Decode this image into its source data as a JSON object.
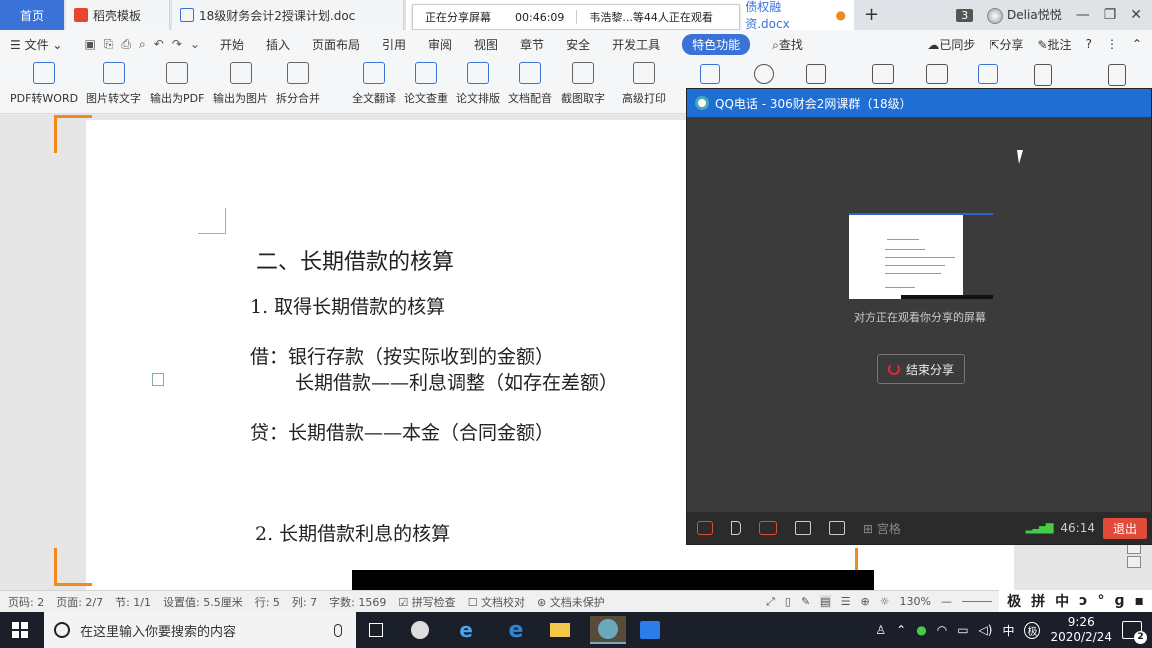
{
  "tabs": {
    "home": "首页",
    "template": "稻壳模板",
    "doc1": "18级财务会计2授课计划.doc",
    "doc2": "债权融资.docx",
    "new_tab": "+",
    "window_count": "3",
    "user": "Delia悦悦"
  },
  "share_banner": {
    "status": "正在分享屏幕",
    "timer": "00:46:09",
    "viewers": "韦浩黎...等44人正在观看"
  },
  "menubar": {
    "file": "文件",
    "items": [
      "开始",
      "插入",
      "页面布局",
      "引用",
      "审阅",
      "视图",
      "章节",
      "安全",
      "开发工具"
    ],
    "special": "特色功能",
    "search": "查找",
    "sync": "已同步",
    "share": "分享",
    "comment": "批注"
  },
  "ribbon": {
    "tools": [
      "PDF转WORD",
      "图片转文字",
      "输出为PDF",
      "输出为图片",
      "拆分合并",
      "全文翻译",
      "论文查重",
      "论文排版",
      "文档配音",
      "截图取字",
      "高级打印"
    ]
  },
  "document": {
    "heading": "二、长期借款的核算",
    "item1": "1. 取得长期借款的核算",
    "debit1": "借：银行存款（按实际收到的金额）",
    "debit2": "长期借款——利息调整（如存在差额）",
    "credit": "贷：长期借款——本金（合同金额）",
    "item2": "2. 长期借款利息的核算"
  },
  "qq": {
    "title": "QQ电话 - 306财会2网课群（18级）",
    "watching": "对方正在观看你分享的屏幕",
    "end_share": "结束分享",
    "grid": "宫格",
    "duration": "46:14",
    "exit": "退出"
  },
  "statusbar": {
    "page": "页码: 2",
    "pages": "页面: 2/7",
    "section": "节: 1/1",
    "setting": "设置值: 5.5厘米",
    "row": "行: 5",
    "col": "列: 7",
    "words": "字数: 1569",
    "spell": "拼写检查",
    "proof": "文档校对",
    "protect": "文档未保护",
    "zoom": "130%"
  },
  "ime": [
    "极",
    "拼",
    "中",
    "ↄ",
    "°",
    "ɡ",
    "▪"
  ],
  "taskbar": {
    "search_placeholder": "在这里输入你要搜索的内容",
    "lang": "中",
    "ime_badge": "极",
    "time": "9:26",
    "date": "2020/2/24",
    "notif_count": "2"
  }
}
